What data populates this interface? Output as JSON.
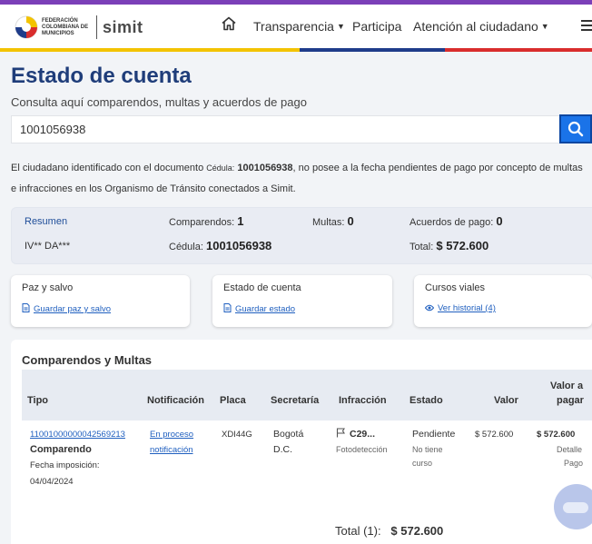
{
  "header": {
    "logo_text": "FEDERACIÓN COLOMBIANA DE MUNICIPIOS",
    "logo_simit": "simit",
    "nav": [
      {
        "label": "Transparencia"
      },
      {
        "label": "Participa"
      },
      {
        "label": "Atención al ciudadano"
      }
    ]
  },
  "page": {
    "title": "Estado de cuenta",
    "subtitle": "Consulta aquí comparendos, multas y acuerdos de pago",
    "search_value": "1001056938"
  },
  "info": {
    "p1": "El ciudadano identificado con el documento ",
    "doc_label": "Cédula:",
    "doc_number": "1001056938",
    "p2": ", no posee a la fecha pendientes de pago por concepto de multas e infracciones en los Organismo de Tránsito conectados a Simit."
  },
  "summary": {
    "resumen_label": "Resumen",
    "name": "IV** DA***",
    "comparendos_label": "Comparendos:",
    "comparendos_value": "1",
    "multas_label": "Multas:",
    "multas_value": "0",
    "acuerdos_label": "Acuerdos de pago:",
    "acuerdos_value": "0",
    "cedula_label": "Cédula:",
    "cedula_value": "1001056938",
    "total_label": "Total:",
    "total_value": "$ 572.600"
  },
  "cards": [
    {
      "title": "Paz y salvo",
      "link": "Guardar paz y salvo"
    },
    {
      "title": "Estado de cuenta",
      "link": "Guardar estado"
    },
    {
      "title": "Cursos viales",
      "link": "Ver historial (4)"
    }
  ],
  "table": {
    "title": "Comparendos y Multas",
    "headers": [
      "Tipo",
      "Notificación",
      "Placa",
      "Secretaría",
      "Infracción",
      "Estado",
      "Valor",
      "Valor a",
      "pagar"
    ],
    "row": {
      "tipo_link": "11001000000042569213",
      "tipo_label": "Comparendo",
      "fecha_label": "Fecha imposición:",
      "fecha_value": "04/04/2024",
      "notificacion_1": "En proceso",
      "notificacion_2": "notificación",
      "placa": "XDI44G",
      "secretaria_1": "Bogotá",
      "secretaria_2": "D.C.",
      "infraccion_code": "C29...",
      "infraccion_sub": "Fotodetección",
      "estado": "Pendiente",
      "estado_sub_1": "No tiene",
      "estado_sub_2": "curso",
      "valor": "$ 572.600",
      "valor_pagar": "$ 572.600",
      "detalle": "Detalle",
      "pago": "Pago"
    },
    "total_label": "Total (1):",
    "total_value": "$ 572.600"
  },
  "colors": {
    "accent": "#1a73e8",
    "title": "#1f3d7a",
    "stripe_yellow": "#f3c300",
    "stripe_blue": "#1f3c8a",
    "stripe_red": "#d92d2d"
  }
}
